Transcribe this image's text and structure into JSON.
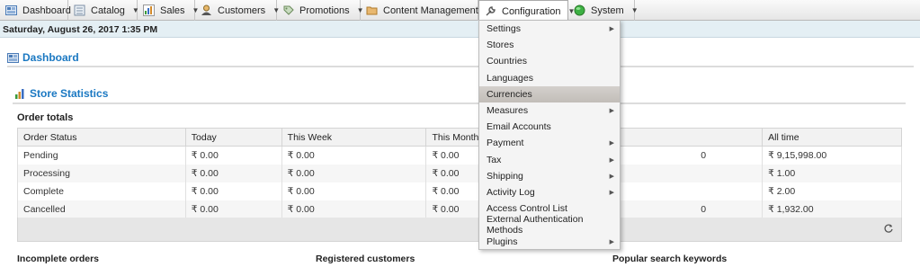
{
  "nav": {
    "items": [
      {
        "label": "Dashboard",
        "icon": "dashboard-icon",
        "has_caret": false
      },
      {
        "label": "Catalog",
        "icon": "catalog-icon",
        "has_caret": true
      },
      {
        "label": "Sales",
        "icon": "sales-icon",
        "has_caret": true
      },
      {
        "label": "Customers",
        "icon": "customers-icon",
        "has_caret": true
      },
      {
        "label": "Promotions",
        "icon": "promotions-icon",
        "has_caret": true
      },
      {
        "label": "Content Management",
        "icon": "content-management-icon",
        "has_caret": true
      },
      {
        "label": "Configuration",
        "icon": "wrench-icon",
        "has_caret": true
      },
      {
        "label": "System",
        "icon": "system-icon",
        "has_caret": true
      }
    ],
    "caret": "▼"
  },
  "datebar": {
    "text": "Saturday, August 26, 2017 1:35 PM"
  },
  "page": {
    "title": "Dashboard"
  },
  "store_stats": {
    "title": "Store Statistics",
    "order_totals_label": "Order totals",
    "columns": [
      "Order Status",
      "Today",
      "This Week",
      "This Month",
      "",
      "All time"
    ],
    "rows": [
      [
        "Pending",
        "₹ 0.00",
        "₹ 0.00",
        "₹ 0.00",
        "0",
        "₹ 9,15,998.00"
      ],
      [
        "Processing",
        "₹ 0.00",
        "₹ 0.00",
        "₹ 0.00",
        "",
        "₹ 1.00"
      ],
      [
        "Complete",
        "₹ 0.00",
        "₹ 0.00",
        "₹ 0.00",
        "",
        "₹ 2.00"
      ],
      [
        "Cancelled",
        "₹ 0.00",
        "₹ 0.00",
        "₹ 0.00",
        "0",
        "₹ 1,932.00"
      ]
    ]
  },
  "bottom": {
    "incomplete_orders": "Incomplete orders",
    "registered_customers": "Registered customers",
    "popular_search_keywords": "Popular search keywords"
  },
  "config_menu": {
    "items": [
      {
        "label": "Settings",
        "submenu": true,
        "highlighted": false
      },
      {
        "label": "Stores",
        "submenu": false,
        "highlighted": false
      },
      {
        "label": "Countries",
        "submenu": false,
        "highlighted": false
      },
      {
        "label": "Languages",
        "submenu": false,
        "highlighted": false
      },
      {
        "label": "Currencies",
        "submenu": false,
        "highlighted": true
      },
      {
        "label": "Measures",
        "submenu": true,
        "highlighted": false
      },
      {
        "label": "Email Accounts",
        "submenu": false,
        "highlighted": false
      },
      {
        "label": "Payment",
        "submenu": true,
        "highlighted": false
      },
      {
        "label": "Tax",
        "submenu": true,
        "highlighted": false
      },
      {
        "label": "Shipping",
        "submenu": true,
        "highlighted": false
      },
      {
        "label": "Activity Log",
        "submenu": true,
        "highlighted": false
      },
      {
        "label": "Access Control List",
        "submenu": false,
        "highlighted": false
      },
      {
        "label": "External Authentication Methods",
        "submenu": false,
        "highlighted": false
      },
      {
        "label": "Plugins",
        "submenu": true,
        "highlighted": false
      }
    ],
    "arrow": "▶"
  },
  "colors": {
    "accent": "#1a78c2",
    "datebar": "#e4eff4",
    "highlight": "#c8c4c0"
  }
}
